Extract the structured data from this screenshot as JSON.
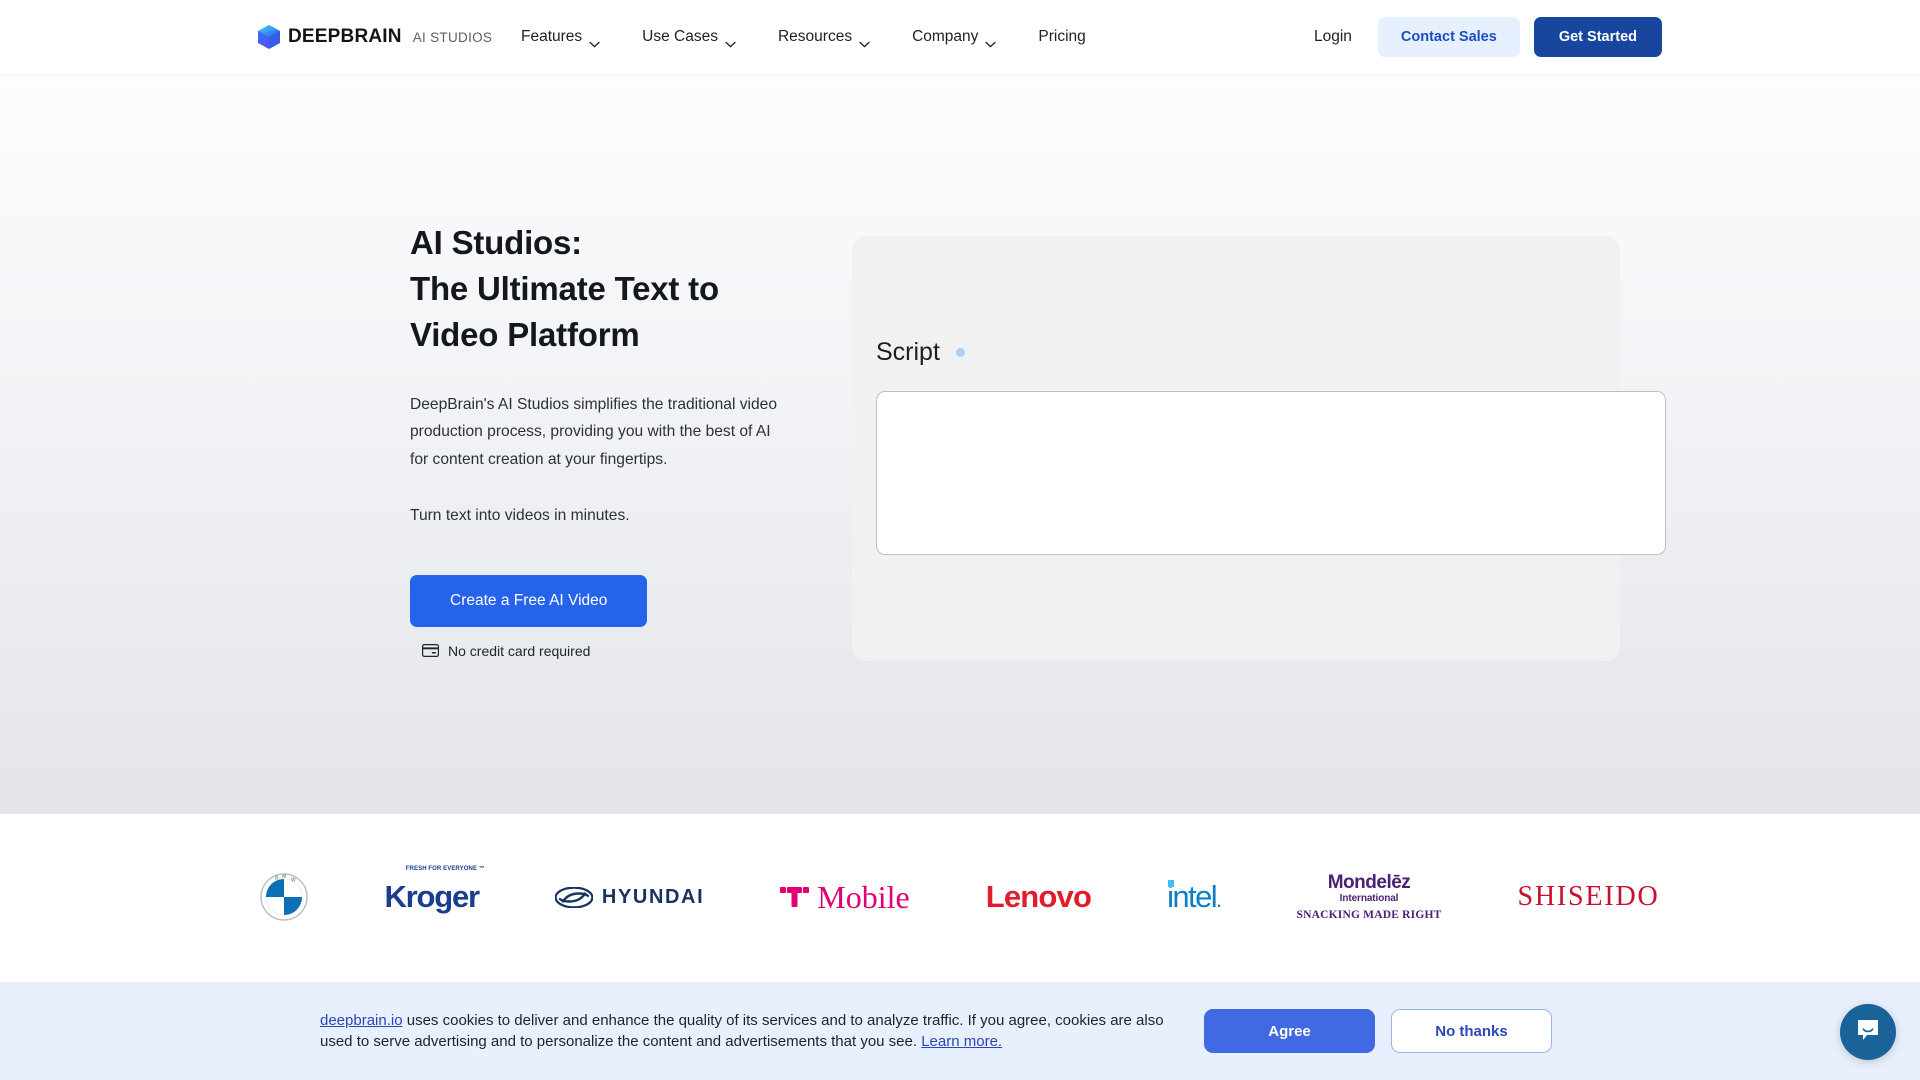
{
  "navbar": {
    "logo": {
      "icon": "deepbrain-cube-icon",
      "word": "DEEPBRAIN",
      "sub": "AI STUDIOS"
    },
    "links": [
      {
        "label": "Features",
        "has_chevron": true
      },
      {
        "label": "Use Cases",
        "has_chevron": true
      },
      {
        "label": "Resources",
        "has_chevron": true
      },
      {
        "label": "Company",
        "has_chevron": true
      },
      {
        "label": "Pricing",
        "has_chevron": false
      }
    ],
    "login_label": "Login",
    "contact_sales_label": "Contact Sales",
    "get_started_label": "Get Started"
  },
  "hero": {
    "title_line1": "AI Studios:",
    "title_line2": "The Ultimate Text to",
    "title_line3": "Video Platform",
    "description": "DeepBrain's AI Studios simplifies the traditional video production process, providing you with the best of AI for content creation at your fingertips.",
    "description2": "Turn text into videos in minutes.",
    "cta_label": "Create a Free AI Video",
    "no_credit_text": "No credit card required",
    "no_credit_icon": "credit-card-icon"
  },
  "script_panel": {
    "label": "Script",
    "dot_color": "#aed0f5",
    "textarea_value": "",
    "textarea_placeholder": ""
  },
  "logos": {
    "items": [
      {
        "name": "BMW",
        "color": "#0066b1"
      },
      {
        "name": "Kroger",
        "color": "#1b3d8f",
        "tagline": "FRESH FOR EVERYONE ™"
      },
      {
        "name": "HYUNDAI",
        "color": "#17335f"
      },
      {
        "name": "T Mobile",
        "color": "#e20074"
      },
      {
        "name": "Lenovo",
        "color": "#e01d2b"
      },
      {
        "name": "intel",
        "color": "#0b7ec4"
      },
      {
        "name": "Mondelēz",
        "sub1": "International",
        "sub2": "SNACKING MADE RIGHT",
        "color": "#4b2273"
      },
      {
        "name": "SHISEIDO",
        "color": "#c8102e"
      }
    ]
  },
  "cookie_banner": {
    "link_domain": "deepbrain.io",
    "text_part1": " uses cookies to deliver and enhance the quality of its services and to analyze traffic. If you agree, cookies are also used to serve advertising and to personalize the content and advertisements that you see. ",
    "learn_more": "Learn more.",
    "agree_label": "Agree",
    "no_thanks_label": "No thanks",
    "background": "#e8effd"
  },
  "chat_widget": {
    "icon": "chat-bubble-icon",
    "color": "#1a6398"
  }
}
